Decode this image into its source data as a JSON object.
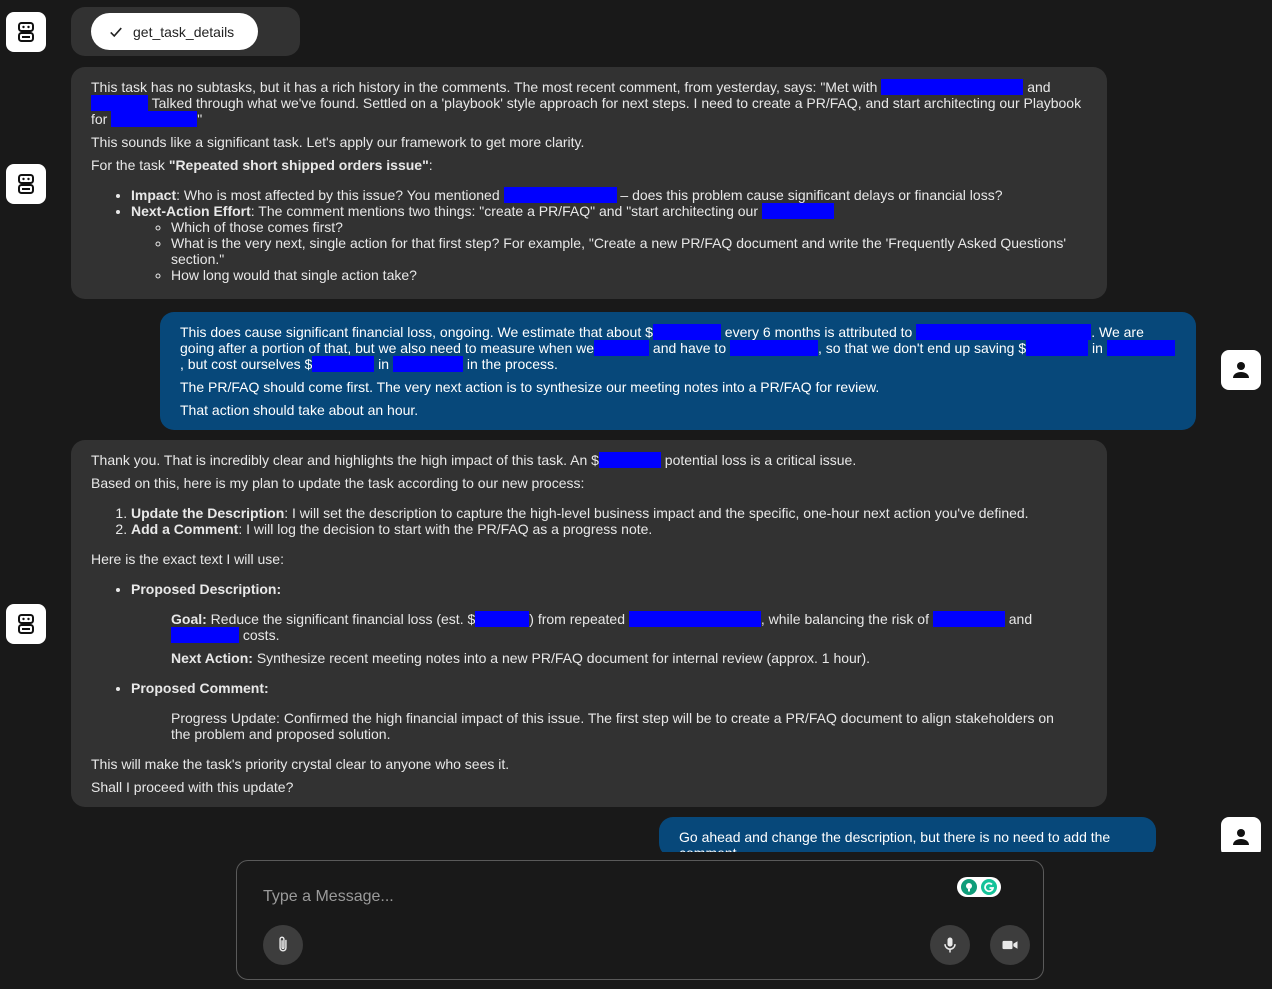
{
  "tool_call": {
    "name": "get_task_details"
  },
  "messages": {
    "bot1": {
      "p1_a": "This task has no subtasks, but it has a rich history in the comments. The most recent comment, from yesterday, says: \"Met with ",
      "p1_b": " and ",
      "p1_c": " Talked through what we've found. Settled on a 'playbook' style approach for next steps. I need to create a PR/FAQ, and start architecting our Playbook for ",
      "p1_d": "\"",
      "p2": "This sounds like a significant task. Let's apply our framework to get more clarity.",
      "p3_a": "For the task ",
      "p3_task": "\"Repeated short shipped orders issue\"",
      "p3_b": ":",
      "impact_label": "Impact",
      "impact_a": ": Who is most affected by this issue? You mentioned ",
      "impact_b": " – does this problem cause significant delays or financial loss?",
      "next_label": "Next-Action Effort",
      "next_a": ": The comment mentions two things: \"create a PR/FAQ\" and \"start architecting our ",
      "sub1": "Which of those comes first?",
      "sub2": "What is the very next, single action for that first step? For example, \"Create a new PR/FAQ document and write the 'Frequently Asked Questions' section.\"",
      "sub3": "How long would that single action take?"
    },
    "user1": {
      "p1_a": "This does cause significant financial loss, ongoing. We estimate that about $",
      "p1_b": " every 6 months is attributed to ",
      "p1_c": ". We are going after a portion of that, but we also need to measure when we",
      "p1_d": " and have to ",
      "p1_e": ", so that we don't end up saving $",
      "p1_f": " in ",
      "p1_g": ", but cost ourselves $",
      "p1_h": " in ",
      "p1_i": " in the process.",
      "p2": "The PR/FAQ should come first. The very next action is to synthesize our meeting notes into a PR/FAQ for review.",
      "p3": "That action should take about an hour."
    },
    "bot2": {
      "p1_a": "Thank you. That is incredibly clear and highlights the high impact of this task. An $",
      "p1_b": " potential loss is a critical issue.",
      "p2": "Based on this, here is my plan to update the task according to our new process:",
      "step1_label": "Update the Description",
      "step1_text": ": I will set the description to capture the high-level business impact and the specific, one-hour next action you've defined.",
      "step2_label": "Add a Comment",
      "step2_text": ": I will log the decision to start with the PR/FAQ as a progress note.",
      "p3": "Here is the exact text I will use:",
      "desc_label": "Proposed Description:",
      "goal_label": "Goal:",
      "goal_a": " Reduce the significant financial loss (est. $",
      "goal_b": ") from repeated ",
      "goal_c": ", while balancing the risk of ",
      "goal_d": " and ",
      "goal_e": " costs.",
      "na_label": "Next Action:",
      "na_text": " Synthesize recent meeting notes into a new PR/FAQ document for internal review (approx. 1 hour).",
      "comment_label": "Proposed Comment:",
      "comment_text": "Progress Update: Confirmed the high financial impact of this issue. The first step will be to create a PR/FAQ document to align stakeholders on the problem and proposed solution.",
      "p4": "This will make the task's priority crystal clear to anyone who sees it.",
      "p5": "Shall I proceed with this update?"
    },
    "user2": {
      "text": "Go ahead and change the description, but there is no need to add the comment."
    }
  },
  "composer": {
    "placeholder": "Type a Message..."
  },
  "colors": {
    "redaction": "#0000ff",
    "user_bubble": "#07487a",
    "bot_bubble": "#323232"
  },
  "icons": [
    "bot-icon",
    "user-icon",
    "check-icon",
    "paperclip-icon",
    "microphone-icon",
    "video-camera-icon",
    "grammarly-icon"
  ]
}
